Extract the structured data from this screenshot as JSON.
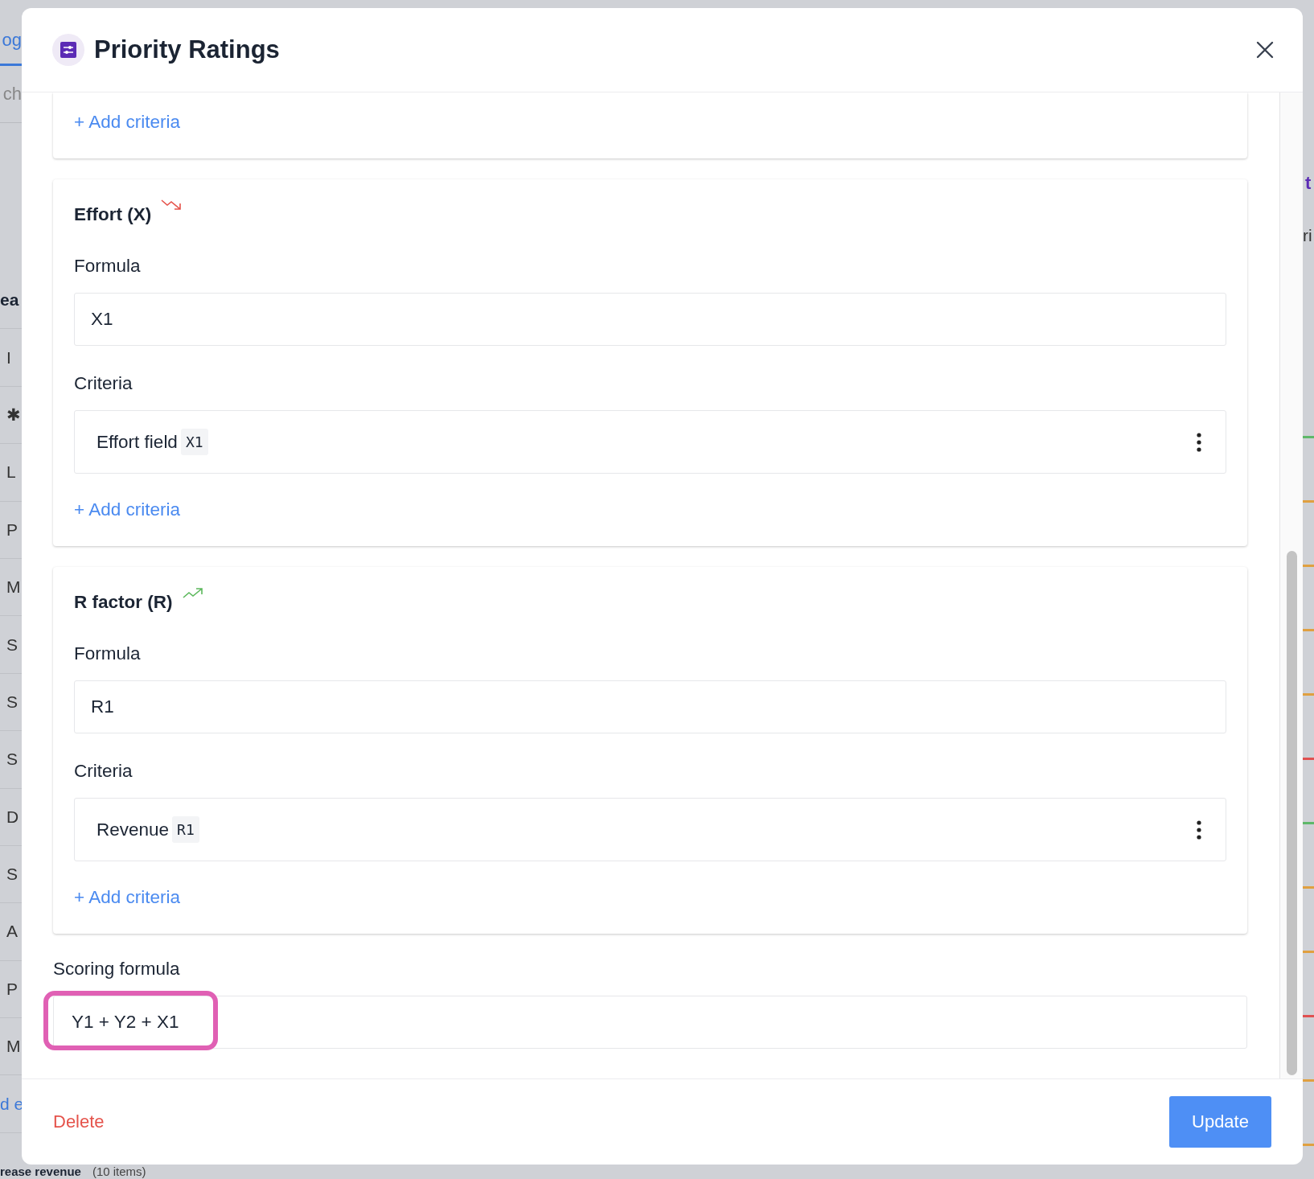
{
  "background": {
    "tab": "og",
    "search": "ch",
    "left_items": [
      {
        "text": "ea",
        "kind": "heading"
      },
      {
        "text": "I",
        "kind": "row"
      },
      {
        "text": "✱",
        "kind": "row"
      },
      {
        "text": "L",
        "kind": "row"
      },
      {
        "text": "P",
        "kind": "row"
      },
      {
        "text": "M",
        "kind": "row"
      },
      {
        "text": "S",
        "kind": "row"
      },
      {
        "text": "S",
        "kind": "row"
      },
      {
        "text": "S",
        "kind": "row"
      },
      {
        "text": "D",
        "kind": "row"
      },
      {
        "text": "S",
        "kind": "row"
      },
      {
        "text": "A",
        "kind": "row"
      },
      {
        "text": "P",
        "kind": "row"
      },
      {
        "text": "M",
        "kind": "row"
      },
      {
        "text": "d e",
        "kind": "link"
      }
    ],
    "group_title": "rease revenue",
    "group_count": "(10 items)",
    "right_heading": "t",
    "right_label": "ri",
    "right_marks": [
      {
        "color": "#5fb86a"
      },
      {
        "color": "#e0a040"
      },
      {
        "color": "#e0a040"
      },
      {
        "color": "#e0a040"
      },
      {
        "color": "#e0a040"
      },
      {
        "color": "#e05050"
      },
      {
        "color": "#5fb86a"
      },
      {
        "color": "#e0a040"
      },
      {
        "color": "#e0a040"
      },
      {
        "color": "#e05050"
      },
      {
        "color": "#e0a040"
      },
      {
        "color": "#e0a040"
      }
    ]
  },
  "dialog": {
    "title": "Priority Ratings",
    "sections": [
      {
        "kind": "partial",
        "add_link": "+ Add criteria"
      },
      {
        "kind": "factor",
        "title": "Effort (X)",
        "trend_up": false,
        "formula_label": "Formula",
        "formula": "X1",
        "criteria_label": "Criteria",
        "criteria": [
          {
            "name": "Effort field",
            "code": "X1"
          }
        ],
        "add_link": "+ Add criteria"
      },
      {
        "kind": "factor",
        "title": "R factor (R)",
        "trend_up": true,
        "formula_label": "Formula",
        "formula": "R1",
        "criteria_label": "Criteria",
        "criteria": [
          {
            "name": "Revenue",
            "code": "R1"
          }
        ],
        "add_link": "+ Add criteria"
      }
    ],
    "scoring": {
      "label": "Scoring formula",
      "value": "Y1 + Y2 + X1",
      "highlighted": true
    },
    "footer": {
      "delete": "Delete",
      "update": "Update"
    }
  }
}
